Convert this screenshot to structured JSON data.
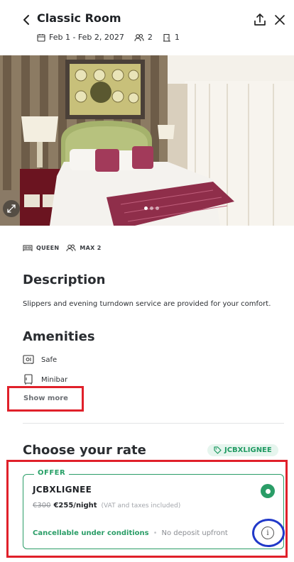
{
  "header": {
    "title": "Classic Room",
    "dates": "Feb 1 - Feb 2, 2027",
    "guests": "2",
    "rooms": "1"
  },
  "gallery": {
    "slide_count": 3,
    "active_slide": 1
  },
  "features": {
    "bed": "QUEEN",
    "capacity": "MAX 2"
  },
  "description": {
    "heading": "Description",
    "text": "Slippers and evening turndown service are provided for your comfort."
  },
  "amenities": {
    "heading": "Amenities",
    "items": [
      {
        "label": "Safe",
        "icon": "safe-icon"
      },
      {
        "label": "Minibar",
        "icon": "minibar-icon"
      }
    ],
    "show_more": "Show more"
  },
  "rates": {
    "heading": "Choose your rate",
    "promo_code": "JCBXLIGNEE",
    "card": {
      "tag": "OFFER",
      "name": "JCBXLIGNEE",
      "old_price": "€300",
      "price": "€255/night",
      "tax_note": "(VAT and taxes included)",
      "cancellation": "Cancellable under conditions",
      "deposit": "No deposit upfront",
      "selected": true
    }
  },
  "colors": {
    "accent_green": "#2a9d67",
    "highlight_red": "#e0202a",
    "highlight_blue": "#2139c9"
  }
}
